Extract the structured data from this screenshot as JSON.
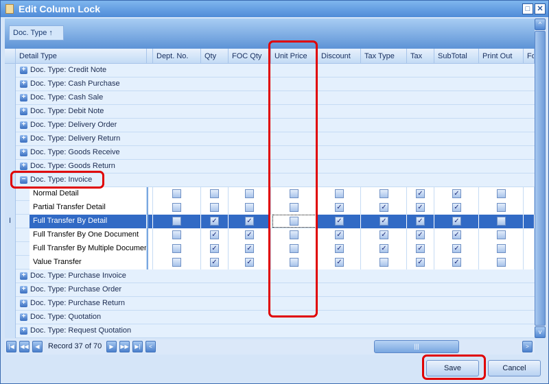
{
  "window": {
    "title": "Edit Column Lock"
  },
  "group_panel": {
    "chip": "Doc. Type ↑"
  },
  "columns": [
    "Detail Type",
    "Dept. No.",
    "Qty",
    "FOC Qty",
    "Unit Price",
    "Discount",
    "Tax Type",
    "Tax",
    "SubTotal",
    "Print Out",
    "Fo"
  ],
  "groups_before": [
    "Doc. Type: Credit Note",
    "Doc. Type: Cash Purchase",
    "Doc. Type: Cash Sale",
    "Doc. Type: Debit Note",
    "Doc. Type: Delivery Order",
    "Doc. Type: Delivery Return",
    "Doc. Type: Goods Receive",
    "Doc. Type: Goods Return"
  ],
  "expanded_group": "Doc. Type: Invoice",
  "detail_rows": [
    {
      "name": "Normal Detail",
      "checks": [
        false,
        false,
        false,
        false,
        false,
        false,
        true,
        true,
        false
      ]
    },
    {
      "name": "Partial Transfer Detail",
      "checks": [
        false,
        false,
        false,
        false,
        true,
        true,
        true,
        true,
        false
      ]
    },
    {
      "name": "Full Transfer By Detail",
      "checks": [
        false,
        true,
        true,
        false,
        true,
        true,
        true,
        true,
        false
      ],
      "selected": true
    },
    {
      "name": "Full Transfer By One Document",
      "checks": [
        false,
        true,
        true,
        false,
        true,
        true,
        true,
        true,
        false
      ]
    },
    {
      "name": "Full Transfer By Multiple Document",
      "checks": [
        false,
        true,
        true,
        false,
        true,
        true,
        true,
        true,
        false
      ]
    },
    {
      "name": "Value Transfer",
      "checks": [
        false,
        true,
        true,
        false,
        true,
        false,
        true,
        true,
        false
      ]
    }
  ],
  "groups_after": [
    "Doc. Type: Purchase Invoice",
    "Doc. Type: Purchase Order",
    "Doc. Type: Purchase Return",
    "Doc. Type: Quotation",
    "Doc. Type: Request Quotation"
  ],
  "navigator": {
    "record_text": "Record 37 of 70"
  },
  "buttons": {
    "save": "Save",
    "cancel": "Cancel"
  },
  "colors": {
    "selection": "#316ac5",
    "highlight": "#e00000"
  }
}
